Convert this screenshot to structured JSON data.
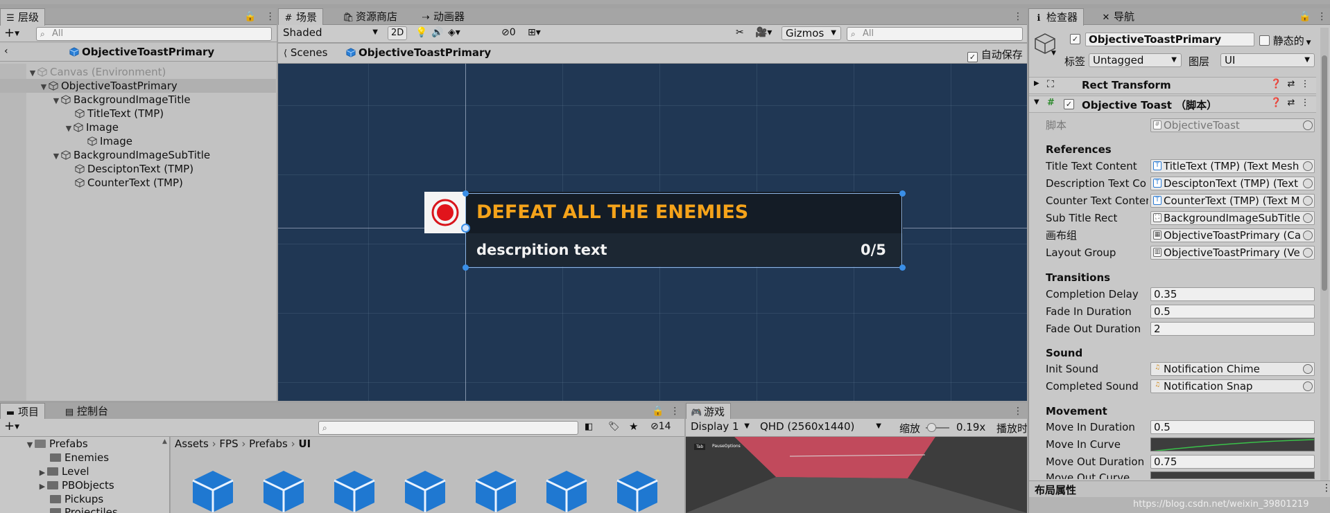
{
  "hierarchy": {
    "tab_label": "层级",
    "search_placeholder": "All",
    "header_title": "ObjectiveToastPrimary",
    "rows": [
      {
        "label": "Canvas (Environment)"
      },
      {
        "label": "ObjectiveToastPrimary"
      },
      {
        "label": "BackgroundImageTitle"
      },
      {
        "label": "TitleText (TMP)"
      },
      {
        "label": "Image"
      },
      {
        "label": "Image"
      },
      {
        "label": "BackgroundImageSubTitle"
      },
      {
        "label": "DesciptonText (TMP)"
      },
      {
        "label": "CounterText (TMP)"
      }
    ]
  },
  "scene": {
    "tabs": [
      "场景",
      "资源商店",
      "动画器"
    ],
    "shading": "Shaded",
    "toggle_2d": "2D",
    "hidden_count": "0",
    "gizmos": "Gizmos",
    "search_placeholder": "All",
    "breadcrumb_root": "Scenes",
    "breadcrumb_prefab": "ObjectiveToastPrimary",
    "autosave_label": "自动保存",
    "toast_title": "DEFEAT ALL THE ENEMIES",
    "toast_description": "descrpition text",
    "toast_counter": "0/5"
  },
  "project": {
    "tabs": [
      "项目",
      "控制台"
    ],
    "hidden_count": "14",
    "tree": [
      "Prefabs",
      "Enemies",
      "Level",
      "PBObjects",
      "Pickups",
      "Projectiles"
    ],
    "breadcrumb": [
      "Assets",
      "FPS",
      "Prefabs",
      "UI"
    ]
  },
  "game": {
    "tab_label": "游戏",
    "display": "Display 1",
    "resolution": "QHD (2560x1440)",
    "scale_label": "缩放",
    "scale_value": "0.19x",
    "play_label": "播放时",
    "mini_badge": "Tab",
    "mini_text": "PauseOptions"
  },
  "inspector": {
    "tabs": [
      "检查器",
      "导航"
    ],
    "object_name": "ObjectiveToastPrimary",
    "static_label": "静态的",
    "tag_label": "标签",
    "tag_value": "Untagged",
    "layer_label": "图层",
    "layer_value": "UI",
    "rect_transform": "Rect Transform",
    "component_title": "Objective Toast （脚本）",
    "script_label": "脚本",
    "script_value": "ObjectiveToast",
    "sections": {
      "references": "References",
      "transitions": "Transitions",
      "sound": "Sound",
      "movement": "Movement"
    },
    "references": [
      {
        "label": "Title Text Content",
        "value": "TitleText (TMP) (Text Mesh"
      },
      {
        "label": "Description Text Co",
        "value": "DesciptonText (TMP) (Text"
      },
      {
        "label": "Counter Text Conter",
        "value": "CounterText (TMP) (Text M"
      },
      {
        "label": "Sub Title Rect",
        "value": "BackgroundImageSubTitle"
      },
      {
        "label": "画布组",
        "value": "ObjectiveToastPrimary (Ca"
      },
      {
        "label": "Layout Group",
        "value": "ObjectiveToastPrimary (Ve"
      }
    ],
    "transitions": [
      {
        "label": "Completion Delay",
        "value": "0.35"
      },
      {
        "label": "Fade In Duration",
        "value": "0.5"
      },
      {
        "label": "Fade Out Duration",
        "value": "2"
      }
    ],
    "sound": [
      {
        "label": "Init Sound",
        "value": "Notification Chime"
      },
      {
        "label": "Completed Sound",
        "value": "Notification Snap"
      }
    ],
    "movement": [
      {
        "label": "Move In Duration",
        "value": "0.5"
      },
      {
        "label": "Move In Curve",
        "value": ""
      },
      {
        "label": "Move Out Duration",
        "value": "0.75"
      },
      {
        "label": "Move Out Curve",
        "value": ""
      }
    ],
    "layout_props": "布局属性",
    "watermark": "https://blog.csdn.net/weixin_39801219"
  },
  "colors": {
    "scene_bg": "#203754",
    "toast_title": "#f5a31a",
    "toast_bg": "#141c26",
    "selection": "#3a72b0",
    "cube_blue": "#1f78d1"
  }
}
